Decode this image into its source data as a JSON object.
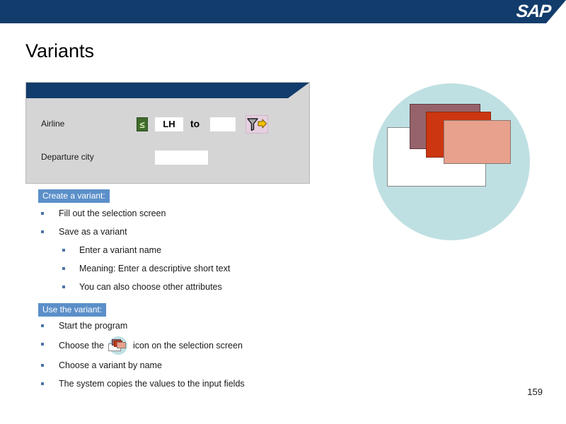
{
  "header": {
    "logo_text": "SAP",
    "logo_name": "sap-logo",
    "bar_color": "#123c6b"
  },
  "slide": {
    "title": "Variants",
    "page_number": "159",
    "background": "#ffffff"
  },
  "selection_panel": {
    "titlebar_color": "#123c6b",
    "body_color": "#d5d5d5",
    "fields": {
      "airline": {
        "label": "Airline",
        "sign_button": "≤",
        "from_value": "LH",
        "to_label": "to",
        "to_value": "",
        "multi_select_icon": "filter-arrow-icon"
      },
      "departure_city": {
        "label": "Departure city",
        "value": ""
      }
    }
  },
  "graphic": {
    "name": "variant-stack-illustration",
    "circle_color": "#bfe0e2",
    "rect_colors": [
      "#ffffff",
      "#96636a",
      "#cc3611",
      "#e8a18c"
    ]
  },
  "content": {
    "accent_color": "#5b8fc9",
    "bullet_color": "#4a74a8",
    "section1": {
      "heading": "Create a variant:",
      "items": [
        {
          "text": "Fill out the selection screen",
          "level": 1
        },
        {
          "text": "Save as a variant",
          "level": 1
        },
        {
          "text": "Enter a variant name",
          "level": 2
        },
        {
          "text": "Meaning: Enter a descriptive short text",
          "level": 2
        },
        {
          "text": "You can also choose other attributes",
          "level": 2
        }
      ]
    },
    "section2": {
      "heading": "Use the variant:",
      "items": [
        {
          "text": "Start the program",
          "level": 1
        },
        {
          "text_before_icon": "Choose the",
          "icon": "variant-icon",
          "text_after_icon": "icon on the selection screen",
          "level": 1
        },
        {
          "text": "Choose a variant by name",
          "level": 1
        },
        {
          "text": "The system copies the values to the input fields",
          "level": 1
        }
      ]
    }
  }
}
